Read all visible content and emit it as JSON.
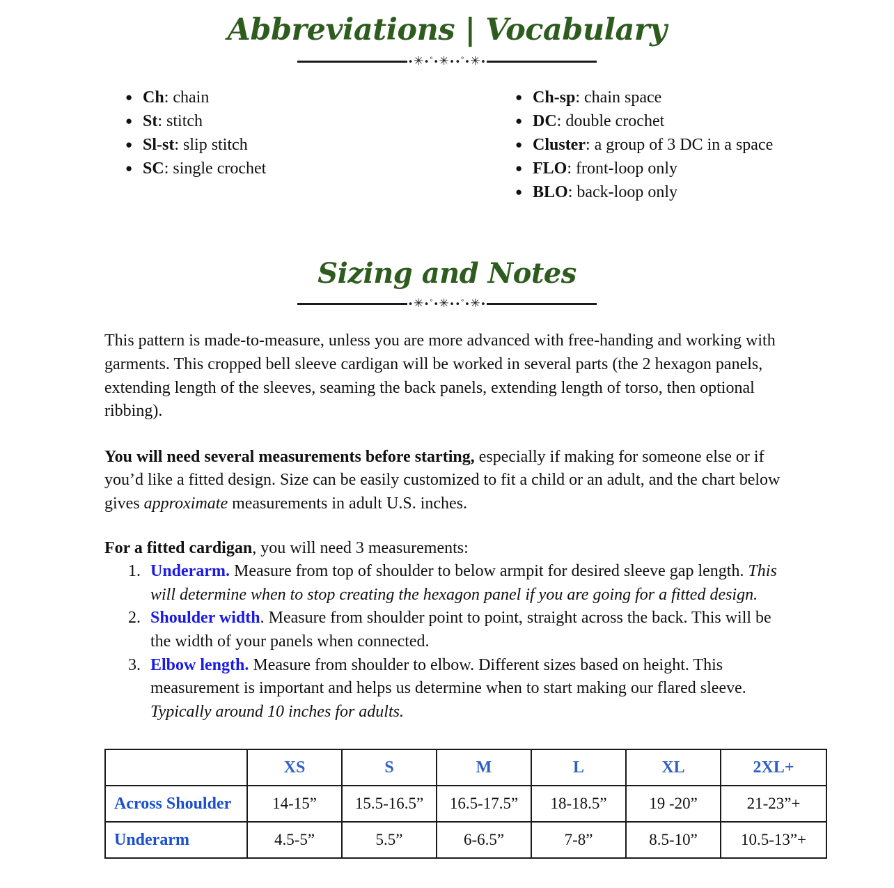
{
  "theme": {
    "heading_green": "#2e5c1f",
    "link_blue": "#1a1aE6",
    "table_header_blue": "#2f5fc4",
    "table_row_header_blue": "#1a4fd0",
    "body_black": "#111111"
  },
  "sections": {
    "abbreviations": {
      "title": "Abbreviations | Vocabulary",
      "left_items": [
        {
          "term": "Ch",
          "sep": ": ",
          "definition": "chain"
        },
        {
          "term": "St",
          "sep": ": ",
          "definition": "stitch"
        },
        {
          "term": "Sl-st",
          "sep": ": ",
          "definition": "slip stitch"
        },
        {
          "term": "SC",
          "sep": ": ",
          "definition": "single crochet"
        }
      ],
      "right_items": [
        {
          "term": "Ch-sp",
          "sep": ": ",
          "definition": "chain space"
        },
        {
          "term": "DC",
          "sep": ": ",
          "definition": "double crochet"
        },
        {
          "term": "Cluster",
          "sep": ": ",
          "definition": "a group of 3 DC in a space"
        },
        {
          "term": "FLO",
          "sep": ": ",
          "definition": "front-loop only"
        },
        {
          "term": "BLO",
          "sep": ": ",
          "definition": "back-loop only"
        }
      ]
    },
    "sizing": {
      "title": "Sizing and Notes",
      "paragraph_1": "This pattern is made-to-measure, unless you are more advanced with free-handing and working with garments. This cropped bell sleeve cardigan will be worked in several parts (the 2 hexagon panels, extending length of the sleeves, seaming the back panels, extending length of torso, then optional ribbing).",
      "paragraph_2": {
        "bold_lead": "You will need several measurements before starting,",
        "text_a": " especially if making for someone else or if you’d like a fitted design. Size can be easily customized to fit a child or an adult, and the chart below gives ",
        "italic": "approximate",
        "text_b": " measurements in adult U.S. inches."
      },
      "intro_list": {
        "bold_lead": "For a fitted cardigan",
        "rest": ", you will need 3 measurements:"
      },
      "measurements": [
        {
          "label": "Underarm.",
          "body": " Measure from top of shoulder to below armpit for desired sleeve gap length. ",
          "italic_note": "This will determine when to stop creating the hexagon panel if you are going for a fitted design."
        },
        {
          "label": "Shoulder width",
          "body": ". Measure from shoulder point to point, straight across the back. This will be the width of your panels when connected.",
          "italic_note": ""
        },
        {
          "label": "Elbow length.",
          "body": " Measure from shoulder to elbow. Different sizes based on height. This measurement is important and helps us determine when to start making our flared sleeve. ",
          "italic_note": "Typically around 10 inches for adults."
        }
      ]
    }
  },
  "size_chart": {
    "corner": "",
    "columns": [
      "XS",
      "S",
      "M",
      "L",
      "XL",
      "2XL+"
    ],
    "rows": [
      {
        "label": "Across Shoulder",
        "values": [
          "14-15”",
          "15.5-16.5”",
          "16.5-17.5”",
          "18-18.5”",
          "19 -20”",
          "21-23”+"
        ]
      },
      {
        "label": "Underarm",
        "values": [
          "4.5-5”",
          "5.5”",
          "6-6.5”",
          "7-8”",
          "8.5-10”",
          "10.5-13”+"
        ]
      }
    ]
  },
  "ornament": {
    "bullet": "•",
    "snowflake": "✳",
    "degree": "°"
  }
}
